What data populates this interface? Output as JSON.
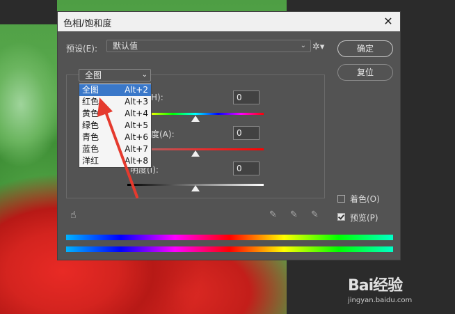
{
  "window": {
    "title": "色相/饱和度",
    "close_glyph": "✕"
  },
  "preset": {
    "label": "预设(E):",
    "value": "默认值"
  },
  "buttons": {
    "ok": "确定",
    "reset": "复位"
  },
  "channel": {
    "selected": "全图"
  },
  "dropdown_items": [
    {
      "name": "全图",
      "shortcut": "Alt+2",
      "selected": true
    },
    {
      "name": "红色",
      "shortcut": "Alt+3",
      "selected": false
    },
    {
      "name": "黄色",
      "shortcut": "Alt+4",
      "selected": false
    },
    {
      "name": "绿色",
      "shortcut": "Alt+5",
      "selected": false
    },
    {
      "name": "青色",
      "shortcut": "Alt+6",
      "selected": false
    },
    {
      "name": "蓝色",
      "shortcut": "Alt+7",
      "selected": false
    },
    {
      "name": "洋红",
      "shortcut": "Alt+8",
      "selected": false
    }
  ],
  "sliders": {
    "hue_label_fragment": "H):",
    "hue_value": "0",
    "saturation_label_fragment": "度(A):",
    "saturation_value": "0",
    "lightness_label_fragment": "明度(I):",
    "lightness_value": "0"
  },
  "options": {
    "colorize_label": "着色(O)",
    "colorize_checked": false,
    "preview_label": "预览(P)",
    "preview_checked": true
  },
  "icons": {
    "gear": "gear-icon",
    "hand": "hand-adjust-icon",
    "eyedropper": "eyedropper-icon",
    "eyedropper_plus": "eyedropper-plus-icon",
    "eyedropper_minus": "eyedropper-minus-icon"
  },
  "watermark": {
    "logo": "Bai经验",
    "url": "jingyan.baidu.com"
  },
  "colors": {
    "dialog_bg": "#535353",
    "selection": "#3a78c9",
    "annotation": "#e53a2e"
  }
}
